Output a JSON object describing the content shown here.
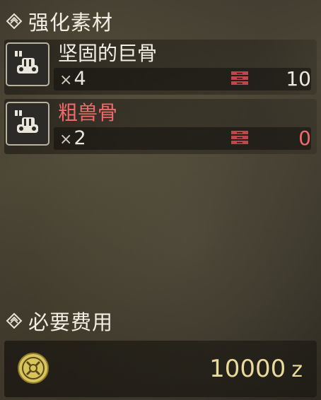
{
  "colors": {
    "text": "#f2efe6",
    "missing": "#ef6b6b",
    "money": "#e9d99a",
    "box_icon": "#c2454b"
  },
  "materials_section": {
    "title": "强化素材",
    "icon": "section-diamond-icon"
  },
  "materials": [
    {
      "name": "坚固的巨骨",
      "icon": "bone-icon",
      "required_prefix": "×",
      "required": "4",
      "owned_icon": "item-box-icon",
      "owned": "10",
      "sufficient": true
    },
    {
      "name": "粗兽骨",
      "icon": "bone-icon",
      "required_prefix": "×",
      "required": "2",
      "owned_icon": "item-box-icon",
      "owned": "0",
      "sufficient": false
    }
  ],
  "cost_section": {
    "title": "必要费用",
    "icon": "section-diamond-icon"
  },
  "cost": {
    "icon": "zenny-coin-icon",
    "amount": "10000",
    "unit": "z"
  }
}
